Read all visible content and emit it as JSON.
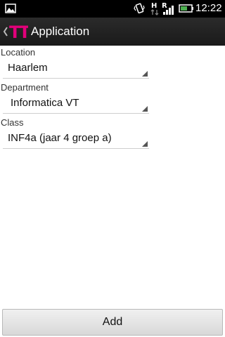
{
  "status_bar": {
    "time": "12:22",
    "icons": [
      "gallery-icon",
      "vibrate-icon",
      "hspa-icon",
      "roaming-signal-icon",
      "battery-icon"
    ],
    "network_letter_h": "H",
    "network_letter_r": "R"
  },
  "action_bar": {
    "title": "Application",
    "logo_color": "#e2007a",
    "logo_text": "TT"
  },
  "form": {
    "location": {
      "label": "Location",
      "value": "Haarlem"
    },
    "department": {
      "label": "Department",
      "value": "Informatica VT"
    },
    "class": {
      "label": "Class",
      "value": "INF4a (jaar 4 groep a)"
    }
  },
  "add_button": {
    "label": "Add"
  }
}
